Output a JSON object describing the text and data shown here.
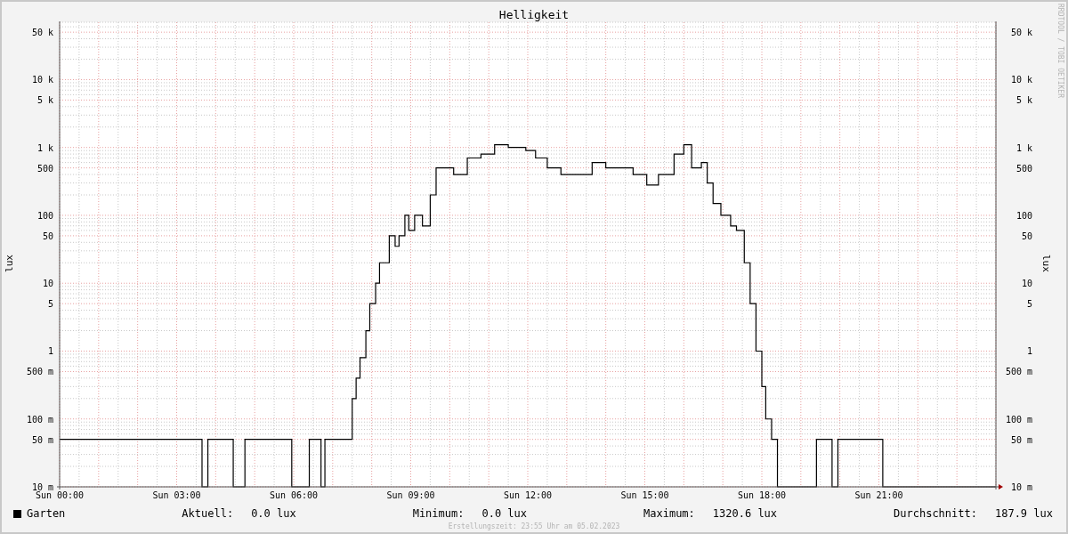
{
  "chart": {
    "title": "Helligkeit",
    "y_axis_label": "lux",
    "y_tick_labels": [
      "50 k",
      "10 k",
      "5 k",
      "1 k",
      "500",
      "100",
      "50",
      "10",
      "5",
      "1",
      "500 m",
      "100 m",
      "50 m",
      "10 m"
    ],
    "x_tick_labels": [
      "Sun 00:00",
      "Sun 03:00",
      "Sun 06:00",
      "Sun 09:00",
      "Sun 12:00",
      "Sun 15:00",
      "Sun 18:00",
      "Sun 21:00"
    ]
  },
  "right_axis": {
    "label": "lux",
    "tick_labels": [
      "50 k",
      "10 k",
      "5 k",
      "1 k",
      "500",
      "100",
      "50",
      "10",
      "5",
      "1",
      "500 m",
      "100 m",
      "50 m",
      "10 m"
    ]
  },
  "watermark": "RRDTOOL / TOBI OETIKER",
  "legend": {
    "name": "Garten",
    "color": "#000000"
  },
  "stats": [
    {
      "label": "Aktuell:",
      "value": "0.0 lux"
    },
    {
      "label": "Minimum:",
      "value": "0.0 lux"
    },
    {
      "label": "Maximum:",
      "value": "1320.6 lux"
    },
    {
      "label": "Durchschnitt:",
      "value": "187.9 lux"
    }
  ],
  "footer": "Erstellungszeit: 23:55 Uhr am 05.02.2023"
}
